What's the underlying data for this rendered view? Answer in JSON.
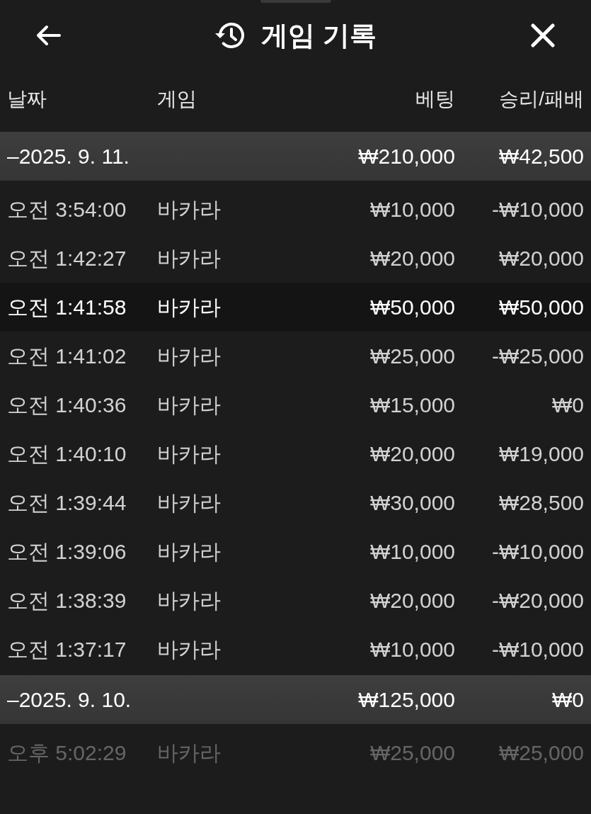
{
  "header": {
    "title": "게임 기록"
  },
  "table": {
    "columns": [
      "날짜",
      "게임",
      "베팅",
      "승리/패배"
    ],
    "groups": [
      {
        "date": "–2025. 9. 11.",
        "bet": "₩210,000",
        "result": "₩42,500",
        "rows": [
          {
            "time": "오전 3:54:00",
            "game": "바카라",
            "bet": "₩10,000",
            "result": "-₩10,000",
            "selected": false,
            "dimmed": false
          },
          {
            "time": "오전 1:42:27",
            "game": "바카라",
            "bet": "₩20,000",
            "result": "₩20,000",
            "selected": false,
            "dimmed": false
          },
          {
            "time": "오전 1:41:58",
            "game": "바카라",
            "bet": "₩50,000",
            "result": "₩50,000",
            "selected": true,
            "dimmed": false
          },
          {
            "time": "오전 1:41:02",
            "game": "바카라",
            "bet": "₩25,000",
            "result": "-₩25,000",
            "selected": false,
            "dimmed": false
          },
          {
            "time": "오전 1:40:36",
            "game": "바카라",
            "bet": "₩15,000",
            "result": "₩0",
            "selected": false,
            "dimmed": false
          },
          {
            "time": "오전 1:40:10",
            "game": "바카라",
            "bet": "₩20,000",
            "result": "₩19,000",
            "selected": false,
            "dimmed": false
          },
          {
            "time": "오전 1:39:44",
            "game": "바카라",
            "bet": "₩30,000",
            "result": "₩28,500",
            "selected": false,
            "dimmed": false
          },
          {
            "time": "오전 1:39:06",
            "game": "바카라",
            "bet": "₩10,000",
            "result": "-₩10,000",
            "selected": false,
            "dimmed": false
          },
          {
            "time": "오전 1:38:39",
            "game": "바카라",
            "bet": "₩20,000",
            "result": "-₩20,000",
            "selected": false,
            "dimmed": false
          },
          {
            "time": "오전 1:37:17",
            "game": "바카라",
            "bet": "₩10,000",
            "result": "-₩10,000",
            "selected": false,
            "dimmed": false
          }
        ]
      },
      {
        "date": "–2025. 9. 10.",
        "bet": "₩125,000",
        "result": "₩0",
        "rows": [
          {
            "time": "오후 5:02:29",
            "game": "바카라",
            "bet": "₩25,000",
            "result": "₩25,000",
            "selected": false,
            "dimmed": true
          }
        ]
      }
    ]
  }
}
